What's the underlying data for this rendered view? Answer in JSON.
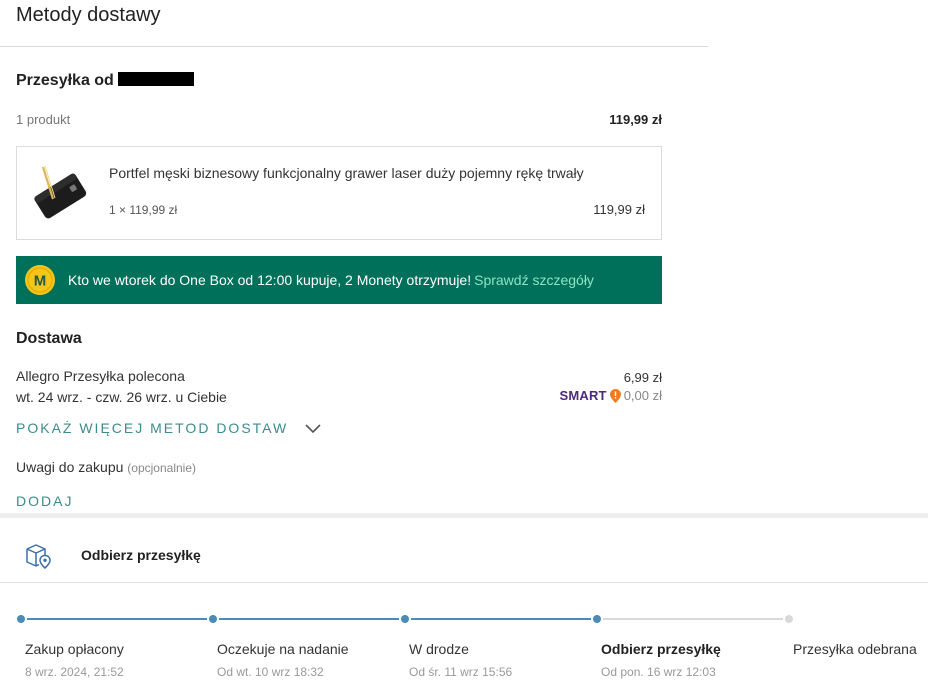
{
  "page_title": "Metody dostawy",
  "seller": {
    "heading_prefix": "Przesyłka od"
  },
  "order_summary": {
    "product_count": "1 produkt",
    "total": "119,99 zł"
  },
  "product": {
    "name": "Portfel męski biznesowy funkcjonalny grawer laser duży pojemny rękę trwały",
    "quantity_line": "1 × 119,99 zł",
    "price": "119,99 zł"
  },
  "promo": {
    "coin_letter": "M",
    "text": "Kto we wtorek do One Box od 12:00 kupuje, 2 Monety otrzymuje!",
    "link": "Sprawdź szczegóły",
    "colors": {
      "background": "#00705a",
      "coin": "#f5c518",
      "link": "#8fe3c2"
    }
  },
  "delivery": {
    "heading": "Dostawa",
    "method_name": "Allegro Przesyłka polecona",
    "dates": "wt. 24 wrz. - czw. 26 wrz. u Ciebie",
    "price": "6,99 zł",
    "smart_logo": "SMART",
    "smart_price": "0,00 zł",
    "more_methods": "POKAŻ WIĘCEJ METOD DOSTAW"
  },
  "notes": {
    "label": "Uwagi do zakupu",
    "optional": "(opcjonalnie)",
    "add": "DODAJ"
  },
  "tracking": {
    "title": "Odbierz przesyłkę",
    "steps": [
      {
        "label": "Zakup opłacony",
        "date": "8 wrz. 2024, 21:52",
        "done": true
      },
      {
        "label": "Oczekuje na nadanie",
        "date": "Od wt. 10 wrz 18:32",
        "done": true
      },
      {
        "label": "W drodze",
        "date": "Od śr. 11 wrz 15:56",
        "done": true
      },
      {
        "label": "Odbierz przesyłkę",
        "date": "Od pon. 16 wrz 12:03",
        "done": true,
        "current": true
      },
      {
        "label": "Przesyłka odebrana",
        "date": "",
        "done": false
      }
    ],
    "colors": {
      "done": "#4a8bb8",
      "pending": "#d9d9d9"
    }
  }
}
